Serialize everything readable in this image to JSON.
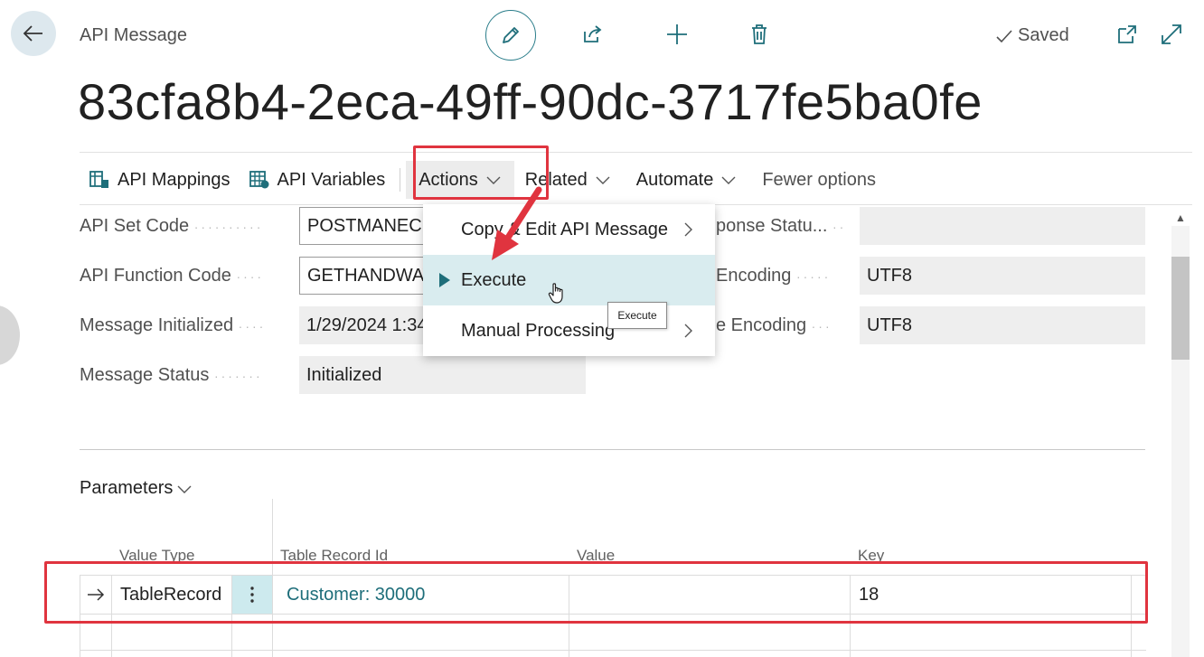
{
  "header": {
    "page_caption": "API Message",
    "status": "Saved",
    "record_title": "83cfa8b4-2eca-49ff-90dc-3717fe5ba0fe"
  },
  "actionbar": {
    "items": [
      "API Mappings",
      "API Variables",
      "Actions",
      "Related",
      "Automate",
      "Fewer options"
    ]
  },
  "fields": {
    "left": [
      {
        "label": "API Set Code",
        "value": "POSTMANECH"
      },
      {
        "label": "API Function Code",
        "value": "GETHANDWAV"
      },
      {
        "label": "Message Initialized",
        "value": "1/29/2024 1:34"
      },
      {
        "label": "Message Status",
        "value": "Initialized"
      }
    ],
    "right": [
      {
        "label": "ponse Statu...",
        "value": ""
      },
      {
        "label": "Encoding",
        "value": "UTF8"
      },
      {
        "label": "e Encoding",
        "value": "UTF8"
      }
    ]
  },
  "actions_menu": {
    "items": [
      "Copy & Edit API Message",
      "Execute",
      "Manual Processing"
    ],
    "tooltip": "Execute"
  },
  "parameters": {
    "heading": "Parameters",
    "columns": [
      "Value Type",
      "Table Record Id",
      "Value",
      "Key"
    ],
    "rows": [
      {
        "value_type": "TableRecord",
        "table_record_id": "Customer: 30000",
        "value": "",
        "key": "18"
      }
    ]
  },
  "colors": {
    "accent": "#1e6e7a",
    "highlight_red": "#e0343f",
    "selected_menu_bg": "#d9ecef"
  }
}
